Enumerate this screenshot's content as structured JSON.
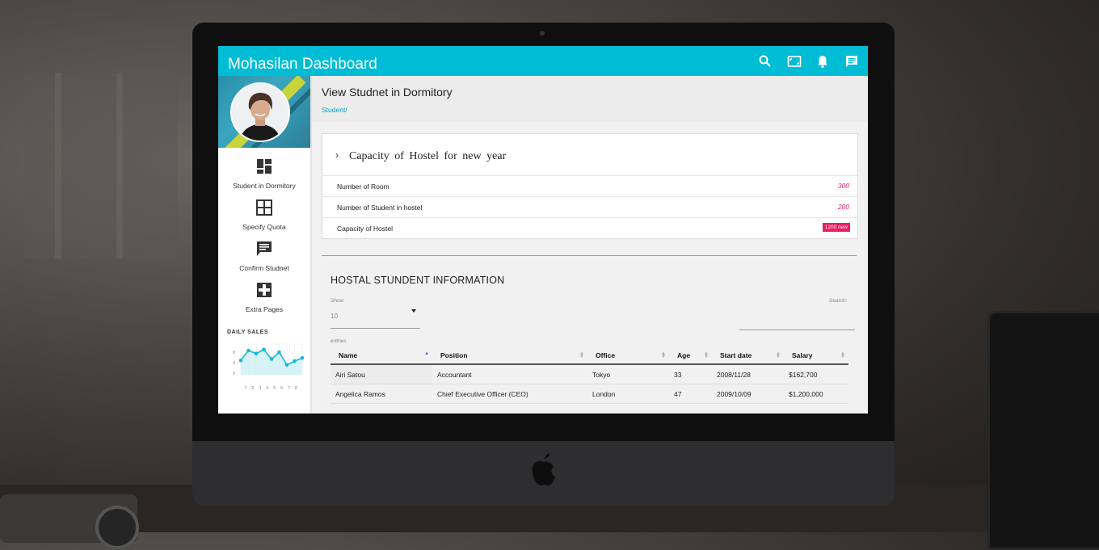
{
  "app": {
    "title": "Mohasilan Dashboard"
  },
  "topbar_icons": [
    "search-icon",
    "fullscreen-icon",
    "bell-icon",
    "message-icon"
  ],
  "sidebar": {
    "items": [
      {
        "label": "Student in Dormitory",
        "icon": "dashboard-icon"
      },
      {
        "label": "Specify Quota",
        "icon": "grid-icon"
      },
      {
        "label": "Confirm Studnet",
        "icon": "comment-icon"
      },
      {
        "label": "Extra Pages",
        "icon": "puzzle-icon"
      }
    ],
    "daily_sales": {
      "title": "DAILY SALES",
      "y_ticks": [
        "8",
        "4",
        "0"
      ],
      "x_ticks": [
        "1",
        "2",
        "3",
        "4",
        "5",
        "6",
        "7",
        "8"
      ],
      "values": [
        4.2,
        7.1,
        6.2,
        7.4,
        4.6,
        6.6,
        2.9,
        4.0,
        4.9
      ]
    }
  },
  "page": {
    "title": "View Studnet in Dormitory",
    "breadcrumb": "Student/"
  },
  "capacity": {
    "title": "Capacity of Hostel for new year",
    "rows": [
      {
        "label": "Number of Room",
        "value": "300"
      },
      {
        "label": "Number of Student in hostel",
        "value": "200"
      },
      {
        "label": "Capacity of Hostel",
        "badge": "1200 new"
      }
    ]
  },
  "table": {
    "title": "HOSTAL STUNDENT INFORMATION",
    "show_label": "Show",
    "show_value": "10",
    "entries_label": "entries",
    "search_label": "Search:",
    "search_value": "",
    "columns": [
      "Name",
      "Position",
      "Office",
      "Age",
      "Start date",
      "Salary"
    ],
    "rows": [
      [
        "Airi Satou",
        "Accountant",
        "Tokyo",
        "33",
        "2008/11/28",
        "$162,700"
      ],
      [
        "Angelica Ramos",
        "Chief Executive Officer (CEO)",
        "London",
        "47",
        "2009/10/09",
        "$1,200,000"
      ]
    ]
  },
  "colors": {
    "accent": "#00bcd4",
    "badge": "#e91e63"
  }
}
